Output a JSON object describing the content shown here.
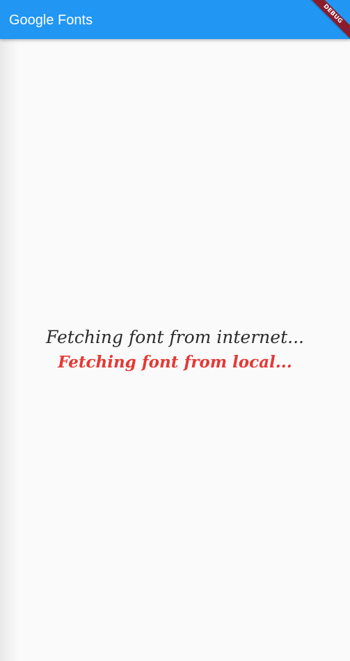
{
  "app_bar": {
    "title": "Google Fonts",
    "background": "#2196f3"
  },
  "debug_banner": {
    "label": "DEBUG",
    "color": "#8b1c2c"
  },
  "content": {
    "internet_message": "Fetching font from internet...",
    "local_message": "Fetching font from local...",
    "local_message_color": "#e53935"
  }
}
